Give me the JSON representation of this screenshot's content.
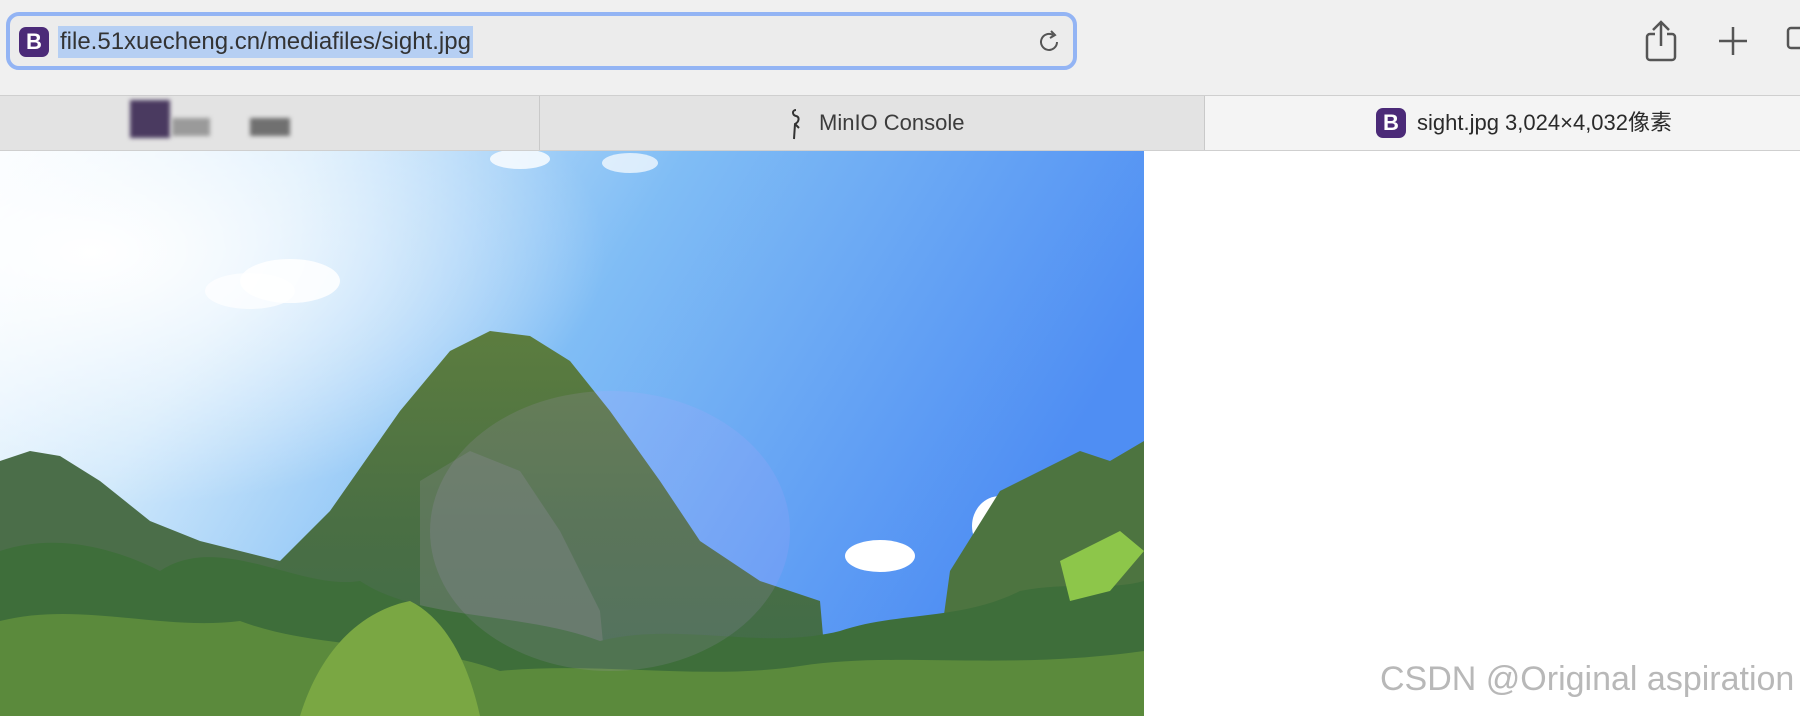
{
  "address_bar": {
    "url": "file.51xuecheng.cn/mediafiles/sight.jpg",
    "site_icon_letter": "B",
    "accent_color": "#93b4f4"
  },
  "toolbar": {
    "share_icon": "share-icon",
    "new_tab_icon": "plus-icon",
    "tab_overview_icon": "tab-overview-icon"
  },
  "tabs": [
    {
      "title": "",
      "active": false,
      "note": "blurred"
    },
    {
      "title": "MinIO Console",
      "active": false,
      "icon": "minio-bird-icon"
    },
    {
      "title": "sight.jpg 3,024×4,032像素",
      "active": true,
      "icon_letter": "B"
    }
  ],
  "image": {
    "subject": "mountain landscape photo"
  },
  "watermark": "CSDN @Original aspiration",
  "colors": {
    "brand_purple": "#4b2a78",
    "selection_blue": "#b6cff3"
  }
}
